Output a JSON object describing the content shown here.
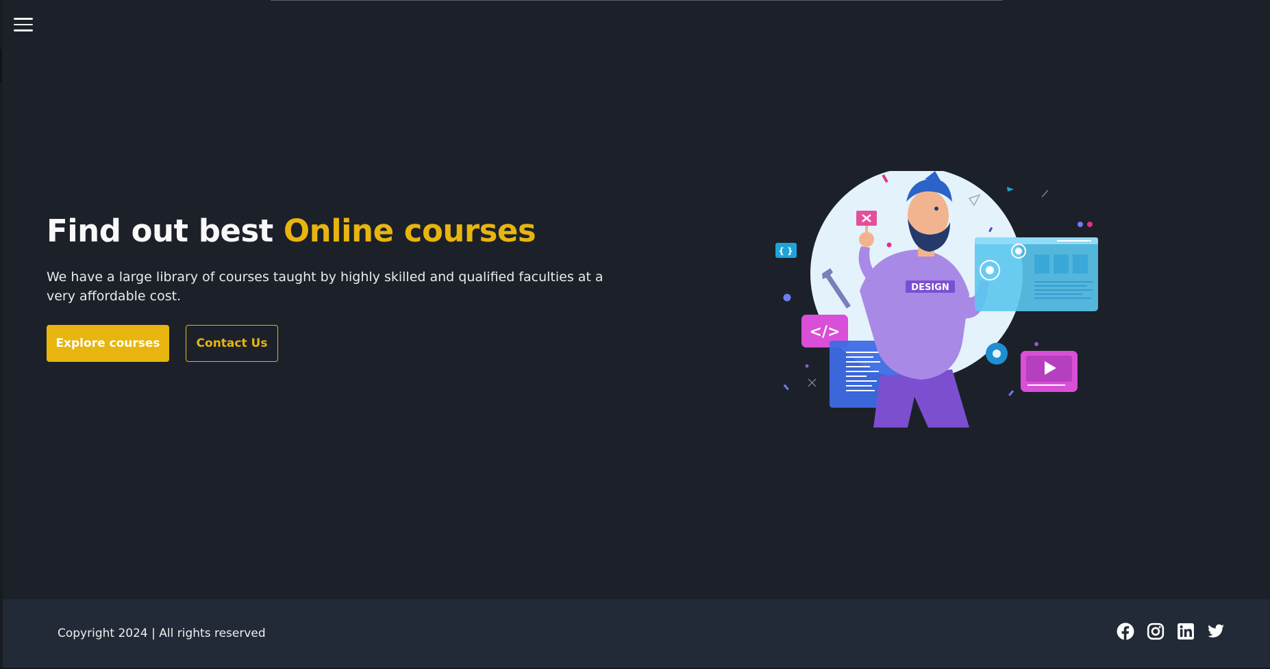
{
  "nav": {
    "menu_icon": "hamburger-menu-icon"
  },
  "hero": {
    "title_prefix": "Find out best ",
    "title_accent": "Online courses",
    "description": "We have a large library of courses taught by highly skilled and qualified faculties at a very affordable cost.",
    "primary_button": "Explore courses",
    "secondary_button": "Contact Us",
    "illustration_badge": "DESIGN",
    "illustration_code_glyph": "</>",
    "illustration_bracket_glyph": "{ }"
  },
  "footer": {
    "copyright": "Copyright 2024 | All rights reserved",
    "social_icons": [
      "facebook-icon",
      "instagram-icon",
      "linkedin-icon",
      "twitter-icon"
    ]
  },
  "colors": {
    "background": "#1c2129",
    "footer_background": "#222a37",
    "accent": "#e8b50f",
    "text": "#ffffff"
  }
}
